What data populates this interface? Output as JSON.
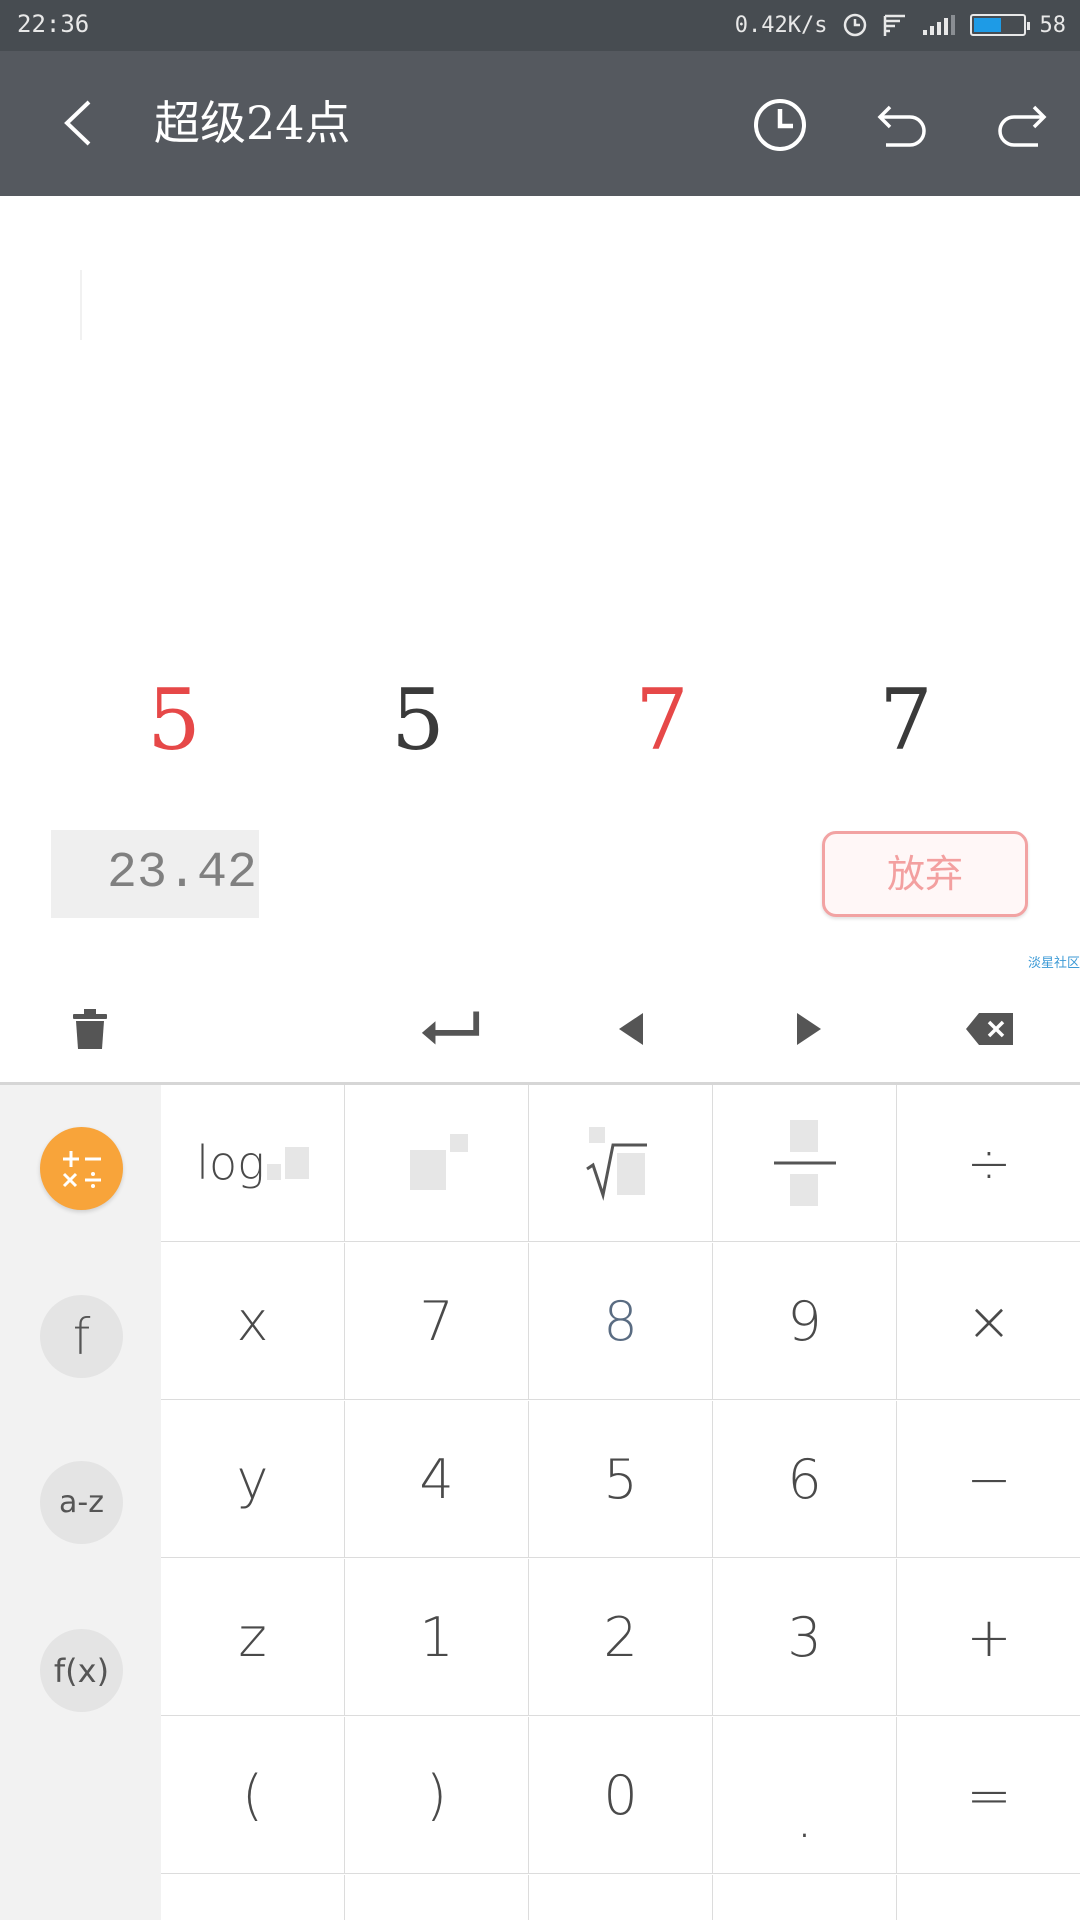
{
  "status_bar": {
    "time": "22:36",
    "network_speed": "0.42K/s",
    "battery_level": "58",
    "battery_fraction": 0.58,
    "icons": [
      "alarm-icon",
      "wifi-icon",
      "signal-icon",
      "battery-icon"
    ]
  },
  "toolbar": {
    "title": "超级24点",
    "icons": [
      "back-icon",
      "history-clock-icon",
      "undo-icon",
      "redo-icon"
    ]
  },
  "game": {
    "cards": [
      {
        "value": "5",
        "color": "#e64848"
      },
      {
        "value": "5",
        "color": "#3a3a3a"
      },
      {
        "value": "7",
        "color": "#e64848"
      },
      {
        "value": "7",
        "color": "#3a3a3a"
      }
    ],
    "timer": "23.42",
    "give_up_label": "放弃",
    "watermark": "淡星社区"
  },
  "edit_row": {
    "icons": [
      "trash-icon",
      "enter-icon",
      "cursor-left-icon",
      "cursor-right-icon",
      "backspace-icon"
    ]
  },
  "keypad": {
    "modes": [
      {
        "label": "+−×÷",
        "name": "mode-arithmetic",
        "active": true
      },
      {
        "label": "f",
        "name": "mode-functions",
        "active": false
      },
      {
        "label": "a-z",
        "name": "mode-variables",
        "active": false
      },
      {
        "label": "f(x)",
        "name": "mode-custom-functions",
        "active": false
      }
    ],
    "row1": {
      "log": "log",
      "divide": "÷"
    },
    "digits_rows": [
      [
        "x",
        "7",
        "8",
        "9",
        "×"
      ],
      [
        "y",
        "4",
        "5",
        "6",
        "−"
      ],
      [
        "z",
        "1",
        "2",
        "3",
        "+"
      ],
      [
        "(",
        ")",
        "0",
        ".",
        "="
      ]
    ]
  },
  "colors": {
    "status_bar": "#474c51",
    "toolbar": "#55595f",
    "accent_orange": "#f8a43a",
    "card_red": "#e64848",
    "give_up_border": "#f2a3a3"
  }
}
